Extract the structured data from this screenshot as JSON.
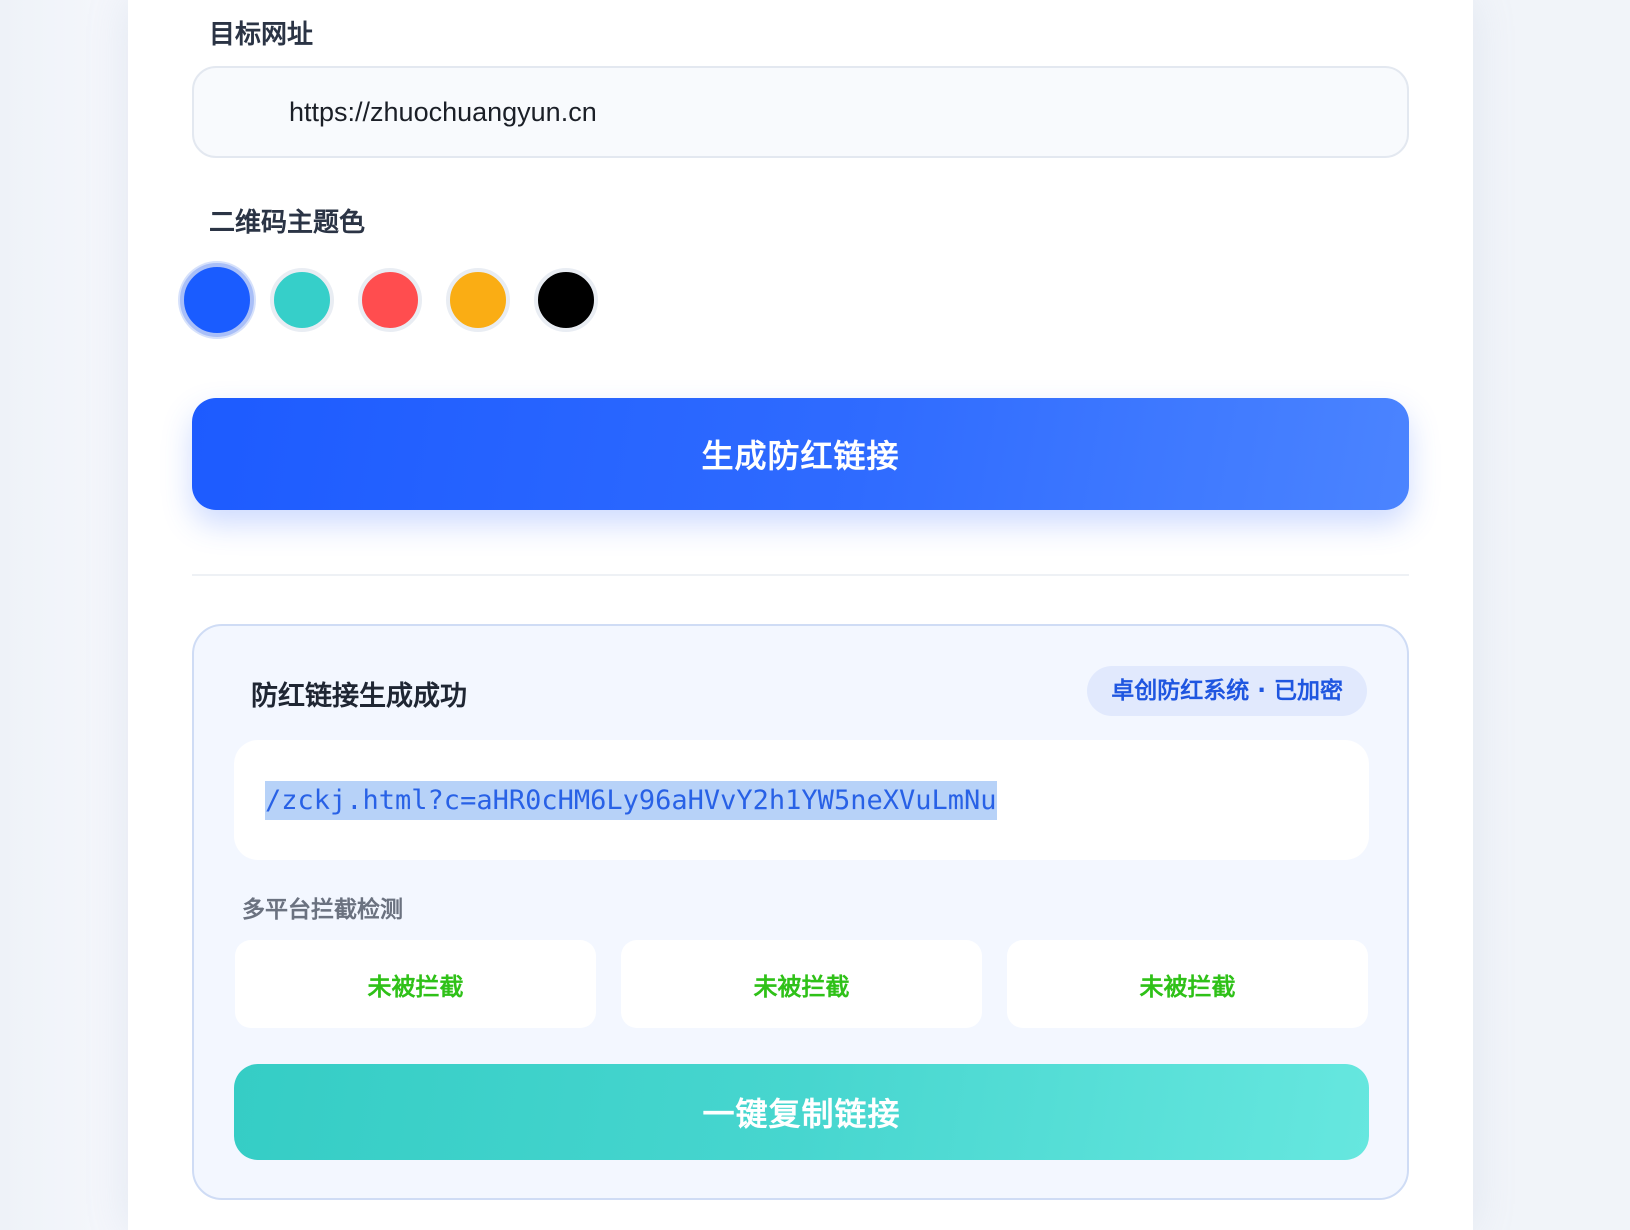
{
  "target_url": {
    "label": "目标网址",
    "value": "https://zhuochuangyun.cn"
  },
  "theme_color": {
    "label": "二维码主题色",
    "options": [
      {
        "color": "#1a5cff",
        "selected": true
      },
      {
        "color": "#36cfc9",
        "selected": false
      },
      {
        "color": "#ff4d4f",
        "selected": false
      },
      {
        "color": "#faad14",
        "selected": false
      },
      {
        "color": "#000000",
        "selected": false
      }
    ]
  },
  "generate_button": {
    "label": "生成防红链接"
  },
  "result": {
    "title": "防红链接生成成功",
    "badge": "卓创防红系统 · 已加密",
    "link": "/zckj.html?c=aHR0cHM6Ly96aHVvY2h1YW5neXVuLmNu",
    "detection_label": "多平台拦截检测",
    "checks": [
      {
        "status": "未被拦截"
      },
      {
        "status": "未被拦截"
      },
      {
        "status": "未被拦截"
      }
    ],
    "copy_button": "一键复制链接"
  },
  "colors": {
    "primary": "#1d5bff",
    "accent_teal": "#36cfc9",
    "success_green": "#2fc118"
  }
}
